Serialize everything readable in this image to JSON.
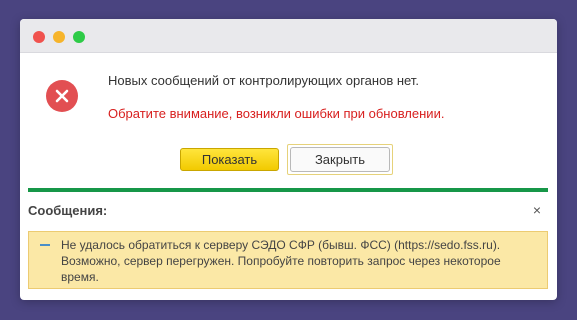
{
  "dialog": {
    "message": "Новых сообщений от контролирующих органов нет.",
    "warning": "Обратите внимание, возникли ошибки при обновлении.",
    "show_button": "Показать",
    "close_button": "Закрыть"
  },
  "messages": {
    "title": "Сообщения:",
    "close_glyph": "×",
    "items": [
      {
        "text": "Не удалось обратиться к серверу СЭДО СФР (бывш. ФСС) (https://sedo.fss.ru). Возможно, сервер перегружен. Попробуйте повторить запрос через некоторое время."
      }
    ]
  },
  "colors": {
    "background": "#4a4480",
    "error_icon": "#e24f52",
    "warning_text": "#d8201f",
    "primary_button": "#f2ca00",
    "divider": "#179748",
    "notice_bg": "#fbe8a6"
  }
}
